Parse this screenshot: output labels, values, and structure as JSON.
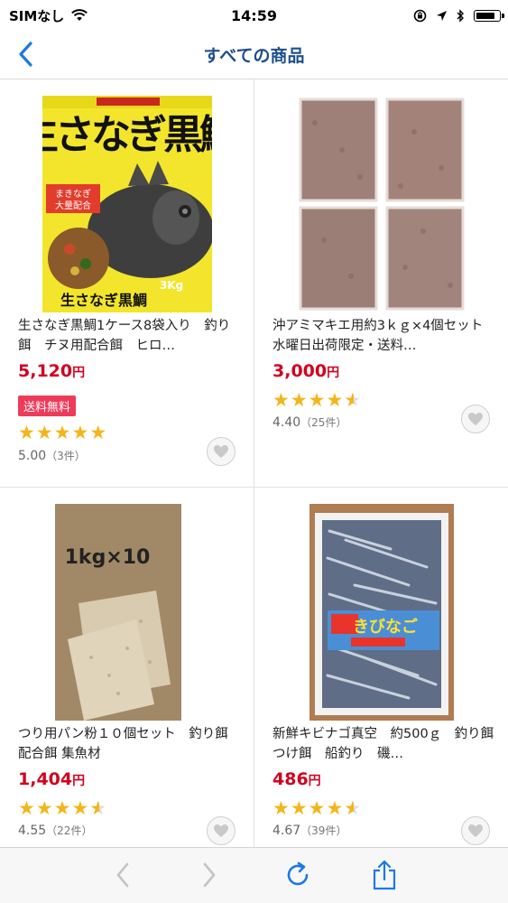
{
  "status_bar": {
    "carrier": "SIMなし",
    "time": "14:59",
    "battery_level": 0.85
  },
  "nav": {
    "title": "すべての商品",
    "back_icon": "chevron-left-icon"
  },
  "products": [
    {
      "name": "生さなぎ黒鯛1ケース8袋入り　釣り餌　チヌ用配合餌　ヒロ…",
      "price": "5,120",
      "price_unit": "円",
      "badge": "送料無料",
      "rating": "5.00",
      "review_count": "（3件）",
      "stars": 5.0
    },
    {
      "name": "沖アミマキエ用約3ｋｇ×4個セット　水曜日出荷限定・送料…",
      "price": "3,000",
      "price_unit": "円",
      "badge": "",
      "rating": "4.40",
      "review_count": "（25件）",
      "stars": 4.5
    },
    {
      "name": "つり用パン粉１０個セット　釣り餌 配合餌 集魚材",
      "price": "1,404",
      "price_unit": "円",
      "badge": "",
      "rating": "4.55",
      "review_count": "（22件）",
      "stars": 4.5
    },
    {
      "name": "新鮮キビナゴ真空　約500ｇ　釣り餌　つけ餌　船釣り　磯…",
      "price": "486",
      "price_unit": "円",
      "badge": "",
      "rating": "4.67",
      "review_count": "（39件）",
      "stars": 4.5
    }
  ],
  "toolbar": {
    "back_icon": "chevron-left-icon",
    "forward_icon": "chevron-right-icon",
    "reload_icon": "reload-icon",
    "share_icon": "share-icon"
  },
  "colors": {
    "nav_title": "#1d4f8c",
    "price": "#d2001e",
    "badge_bg": "#ee3b5a",
    "star": "#f4b51b",
    "link_blue": "#1a7ae6"
  }
}
